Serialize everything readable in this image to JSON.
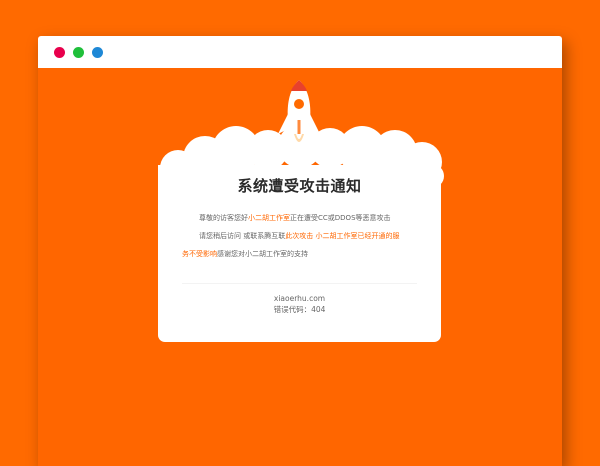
{
  "window": {
    "controls": [
      "close-dot",
      "minimize-dot",
      "maximize-dot"
    ]
  },
  "colors": {
    "background": "#ff6a00",
    "accent": "#ff6600",
    "card": "#ffffff",
    "highlight": "#ff6600"
  },
  "notice": {
    "title": "系统遭受攻击通知",
    "line1": {
      "pre": "尊敬的访客您好",
      "highlight": "小二胡工作室",
      "post": "正在遭受CC或DDOS等恶意攻击"
    },
    "line2": {
      "pre": "请您稍后访问 或联系腾互联",
      "highlight": "此次攻击 小二胡工作室已经开通的服"
    },
    "line3": {
      "highlight": "务不受影响",
      "post": "感谢您对小二胡工作室的支持"
    },
    "footer_domain": "xiaoerhu.com",
    "footer_error_label": "错误代码：",
    "footer_error_code": "404"
  },
  "icons": {
    "rocket": "rocket-icon",
    "clouds": "cloud-decoration"
  }
}
